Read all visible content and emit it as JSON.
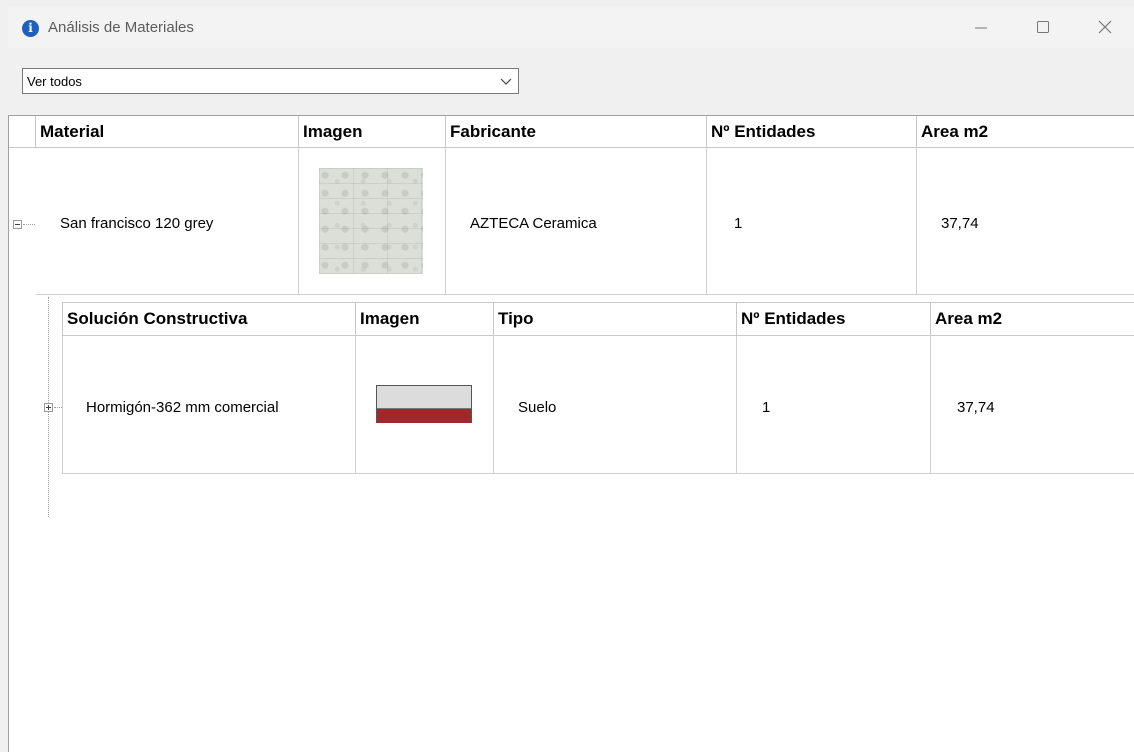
{
  "window": {
    "title": "Análisis de Materiales"
  },
  "filter": {
    "selected": "Ver todos"
  },
  "materials": {
    "columns": [
      "Material",
      "Imagen",
      "Fabricante",
      "Nº Entidades",
      "Area m2"
    ],
    "rows": [
      {
        "material": "San francisco 120 grey",
        "image": "grey-stone-tile-texture",
        "manufacturer": "AZTECA Ceramica",
        "entities": "1",
        "area": "37,74"
      }
    ]
  },
  "solutions": {
    "columns": [
      "Solución Constructiva",
      "Imagen",
      "Tipo",
      "Nº Entidades",
      "Area m2"
    ],
    "rows": [
      {
        "name": "Hormigón-362 mm comercial",
        "image": "layer-section-swatch",
        "type": "Suelo",
        "entities": "1",
        "area": "37,74"
      }
    ]
  },
  "colors": {
    "swatch_top": "#dcdcdc",
    "swatch_bottom": "#a02828",
    "info_icon": "#1f5fbf"
  }
}
